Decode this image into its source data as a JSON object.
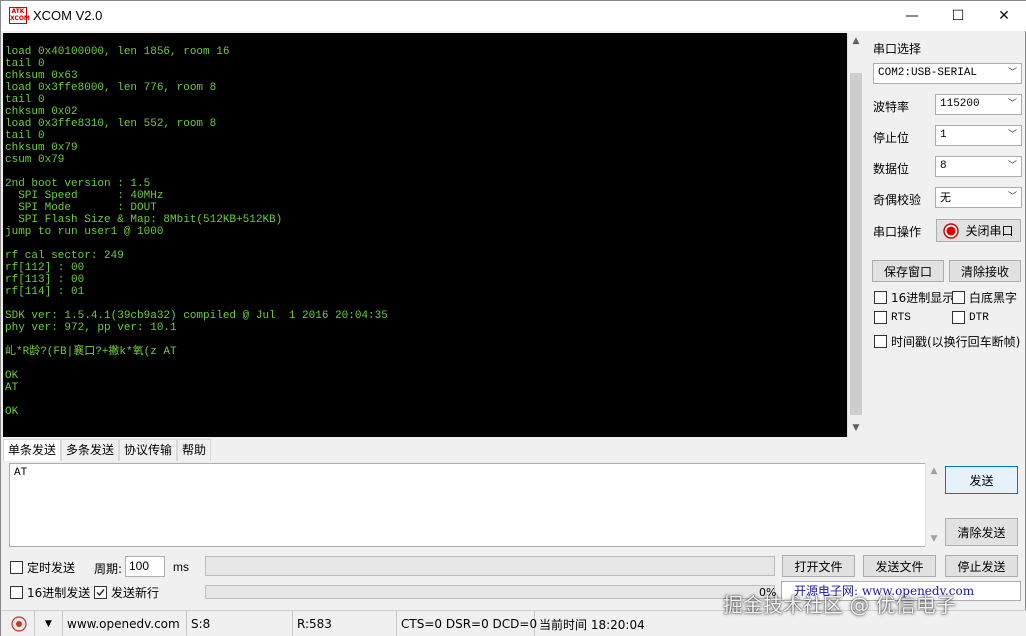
{
  "window": {
    "title": "XCOM V2.0",
    "icon_text": "ATK XCOM",
    "minimize": "—",
    "maximize": "☐",
    "close": "✕"
  },
  "terminal": {
    "lines": [
      "load 0x40100000, len 1856, room 16",
      "tail 0",
      "chksum 0x63",
      "load 0x3ffe8000, len 776, room 8",
      "tail 0",
      "chksum 0x02",
      "load 0x3ffe8310, len 552, room 8",
      "tail 0",
      "chksum 0x79",
      "csum 0x79",
      "",
      "2nd boot version : 1.5",
      "  SPI Speed      : 40MHz",
      "  SPI Mode       : DOUT",
      "  SPI Flash Size & Map: 8Mbit(512KB+512KB)",
      "jump to run user1 @ 1000",
      "",
      "rf cal sector: 249",
      "rf[112] : 00",
      "rf[113] : 00",
      "rf[114] : 01",
      "",
      "SDK ver: 1.5.4.1(39cb9a32) compiled @ Jul  1 2016 20:04:35",
      "phy ver: 972, pp ver: 10.1",
      "",
      "乢*R龄?(FB|襄口?+撇k*氧(z AT",
      "",
      "OK",
      "AT",
      "",
      "OK"
    ]
  },
  "settings": {
    "port_label": "串口选择",
    "port_value": "COM2:USB-SERIAL",
    "baud_label": "波特率",
    "baud_value": "115200",
    "stop_label": "停止位",
    "stop_value": "1",
    "data_label": "数据位",
    "data_value": "8",
    "parity_label": "奇偶校验",
    "parity_value": "无",
    "op_label": "串口操作",
    "op_button": "关闭串口",
    "save_window": "保存窗口",
    "clear_receive": "清除接收",
    "hex_display": "16进制显示",
    "white_bg": "白底黑字",
    "rts": "RTS",
    "dtr": "DTR",
    "timestamp": "时间戳(以换行回车断帧)"
  },
  "tabs": [
    "单条发送",
    "多条发送",
    "协议传输",
    "帮助"
  ],
  "send": {
    "text": "AT",
    "send_button": "发送",
    "clear_send_button": "清除发送",
    "timed_send": "定时发送",
    "period_label": "周期:",
    "period_value": "100",
    "period_unit": "ms",
    "open_file": "打开文件",
    "send_file": "发送文件",
    "stop_send": "停止发送",
    "hex_send": "16进制发送",
    "send_newline": "发送新行",
    "percent": "0%",
    "ad_text": "开源电子网: www.openedv.com"
  },
  "status": {
    "url": "www.openedv.com",
    "sent": "S:8",
    "received": "R:583",
    "lines": "CTS=0 DSR=0 DCD=0",
    "time": "当前时间 18:20:04"
  },
  "watermark": "掘金技术社区 @ 优信电子"
}
